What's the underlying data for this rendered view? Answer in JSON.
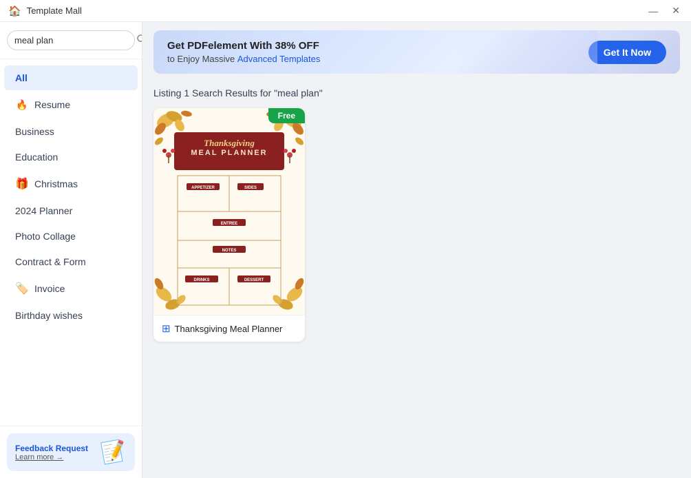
{
  "titleBar": {
    "title": "Template Mall",
    "homeIcon": "🏠",
    "minimizeBtn": "—",
    "closeBtn": "✕"
  },
  "search": {
    "value": "meal plan",
    "placeholder": "meal plan"
  },
  "sidebar": {
    "items": [
      {
        "id": "all",
        "label": "All",
        "icon": null,
        "active": true
      },
      {
        "id": "resume",
        "label": "Resume",
        "icon": "fire",
        "active": false
      },
      {
        "id": "business",
        "label": "Business",
        "icon": null,
        "active": false
      },
      {
        "id": "education",
        "label": "Education",
        "icon": null,
        "active": false
      },
      {
        "id": "christmas",
        "label": "Christmas",
        "icon": "gift",
        "active": false
      },
      {
        "id": "2024planner",
        "label": "2024 Planner",
        "icon": null,
        "active": false
      },
      {
        "id": "photocollage",
        "label": "Photo Collage",
        "icon": null,
        "active": false
      },
      {
        "id": "contractform",
        "label": "Contract & Form",
        "icon": null,
        "active": false
      },
      {
        "id": "invoice",
        "label": "Invoice",
        "icon": "tag",
        "active": false
      },
      {
        "id": "birthdaywishes",
        "label": "Birthday wishes",
        "icon": null,
        "active": false
      }
    ],
    "feedbackCard": {
      "title": "Feedback Request",
      "subLabel": "Learn more →",
      "icon": "📝"
    }
  },
  "banner": {
    "title": "Get PDFelement With 38% OFF",
    "subtitle": "to Enjoy Massive",
    "highlight": "Advanced Templates",
    "buttonLabel": "Get It Now"
  },
  "results": {
    "count": 1,
    "query": "meal plan",
    "title": "Listing 1 Search Results for \"meal plan\"",
    "templates": [
      {
        "id": "thanksgiving-meal-planner",
        "label": "Thanksgiving Meal Planner",
        "free": true,
        "freeBadge": "Free"
      }
    ]
  }
}
